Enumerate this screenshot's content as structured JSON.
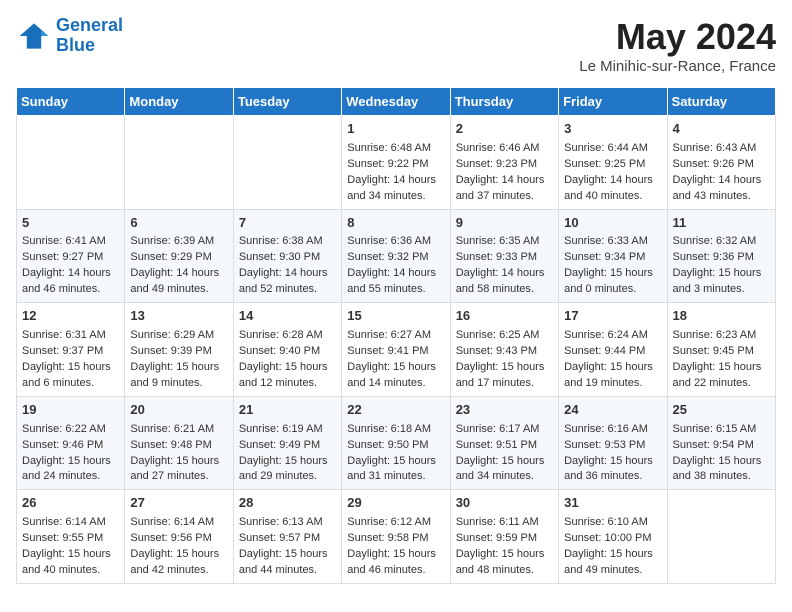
{
  "header": {
    "logo_general": "General",
    "logo_blue": "Blue",
    "month_title": "May 2024",
    "location": "Le Minihic-sur-Rance, France"
  },
  "weekdays": [
    "Sunday",
    "Monday",
    "Tuesday",
    "Wednesday",
    "Thursday",
    "Friday",
    "Saturday"
  ],
  "weeks": [
    [
      {
        "day": "",
        "sunrise": "",
        "sunset": "",
        "daylight": ""
      },
      {
        "day": "",
        "sunrise": "",
        "sunset": "",
        "daylight": ""
      },
      {
        "day": "",
        "sunrise": "",
        "sunset": "",
        "daylight": ""
      },
      {
        "day": "1",
        "sunrise": "Sunrise: 6:48 AM",
        "sunset": "Sunset: 9:22 PM",
        "daylight": "Daylight: 14 hours and 34 minutes."
      },
      {
        "day": "2",
        "sunrise": "Sunrise: 6:46 AM",
        "sunset": "Sunset: 9:23 PM",
        "daylight": "Daylight: 14 hours and 37 minutes."
      },
      {
        "day": "3",
        "sunrise": "Sunrise: 6:44 AM",
        "sunset": "Sunset: 9:25 PM",
        "daylight": "Daylight: 14 hours and 40 minutes."
      },
      {
        "day": "4",
        "sunrise": "Sunrise: 6:43 AM",
        "sunset": "Sunset: 9:26 PM",
        "daylight": "Daylight: 14 hours and 43 minutes."
      }
    ],
    [
      {
        "day": "5",
        "sunrise": "Sunrise: 6:41 AM",
        "sunset": "Sunset: 9:27 PM",
        "daylight": "Daylight: 14 hours and 46 minutes."
      },
      {
        "day": "6",
        "sunrise": "Sunrise: 6:39 AM",
        "sunset": "Sunset: 9:29 PM",
        "daylight": "Daylight: 14 hours and 49 minutes."
      },
      {
        "day": "7",
        "sunrise": "Sunrise: 6:38 AM",
        "sunset": "Sunset: 9:30 PM",
        "daylight": "Daylight: 14 hours and 52 minutes."
      },
      {
        "day": "8",
        "sunrise": "Sunrise: 6:36 AM",
        "sunset": "Sunset: 9:32 PM",
        "daylight": "Daylight: 14 hours and 55 minutes."
      },
      {
        "day": "9",
        "sunrise": "Sunrise: 6:35 AM",
        "sunset": "Sunset: 9:33 PM",
        "daylight": "Daylight: 14 hours and 58 minutes."
      },
      {
        "day": "10",
        "sunrise": "Sunrise: 6:33 AM",
        "sunset": "Sunset: 9:34 PM",
        "daylight": "Daylight: 15 hours and 0 minutes."
      },
      {
        "day": "11",
        "sunrise": "Sunrise: 6:32 AM",
        "sunset": "Sunset: 9:36 PM",
        "daylight": "Daylight: 15 hours and 3 minutes."
      }
    ],
    [
      {
        "day": "12",
        "sunrise": "Sunrise: 6:31 AM",
        "sunset": "Sunset: 9:37 PM",
        "daylight": "Daylight: 15 hours and 6 minutes."
      },
      {
        "day": "13",
        "sunrise": "Sunrise: 6:29 AM",
        "sunset": "Sunset: 9:39 PM",
        "daylight": "Daylight: 15 hours and 9 minutes."
      },
      {
        "day": "14",
        "sunrise": "Sunrise: 6:28 AM",
        "sunset": "Sunset: 9:40 PM",
        "daylight": "Daylight: 15 hours and 12 minutes."
      },
      {
        "day": "15",
        "sunrise": "Sunrise: 6:27 AM",
        "sunset": "Sunset: 9:41 PM",
        "daylight": "Daylight: 15 hours and 14 minutes."
      },
      {
        "day": "16",
        "sunrise": "Sunrise: 6:25 AM",
        "sunset": "Sunset: 9:43 PM",
        "daylight": "Daylight: 15 hours and 17 minutes."
      },
      {
        "day": "17",
        "sunrise": "Sunrise: 6:24 AM",
        "sunset": "Sunset: 9:44 PM",
        "daylight": "Daylight: 15 hours and 19 minutes."
      },
      {
        "day": "18",
        "sunrise": "Sunrise: 6:23 AM",
        "sunset": "Sunset: 9:45 PM",
        "daylight": "Daylight: 15 hours and 22 minutes."
      }
    ],
    [
      {
        "day": "19",
        "sunrise": "Sunrise: 6:22 AM",
        "sunset": "Sunset: 9:46 PM",
        "daylight": "Daylight: 15 hours and 24 minutes."
      },
      {
        "day": "20",
        "sunrise": "Sunrise: 6:21 AM",
        "sunset": "Sunset: 9:48 PM",
        "daylight": "Daylight: 15 hours and 27 minutes."
      },
      {
        "day": "21",
        "sunrise": "Sunrise: 6:19 AM",
        "sunset": "Sunset: 9:49 PM",
        "daylight": "Daylight: 15 hours and 29 minutes."
      },
      {
        "day": "22",
        "sunrise": "Sunrise: 6:18 AM",
        "sunset": "Sunset: 9:50 PM",
        "daylight": "Daylight: 15 hours and 31 minutes."
      },
      {
        "day": "23",
        "sunrise": "Sunrise: 6:17 AM",
        "sunset": "Sunset: 9:51 PM",
        "daylight": "Daylight: 15 hours and 34 minutes."
      },
      {
        "day": "24",
        "sunrise": "Sunrise: 6:16 AM",
        "sunset": "Sunset: 9:53 PM",
        "daylight": "Daylight: 15 hours and 36 minutes."
      },
      {
        "day": "25",
        "sunrise": "Sunrise: 6:15 AM",
        "sunset": "Sunset: 9:54 PM",
        "daylight": "Daylight: 15 hours and 38 minutes."
      }
    ],
    [
      {
        "day": "26",
        "sunrise": "Sunrise: 6:14 AM",
        "sunset": "Sunset: 9:55 PM",
        "daylight": "Daylight: 15 hours and 40 minutes."
      },
      {
        "day": "27",
        "sunrise": "Sunrise: 6:14 AM",
        "sunset": "Sunset: 9:56 PM",
        "daylight": "Daylight: 15 hours and 42 minutes."
      },
      {
        "day": "28",
        "sunrise": "Sunrise: 6:13 AM",
        "sunset": "Sunset: 9:57 PM",
        "daylight": "Daylight: 15 hours and 44 minutes."
      },
      {
        "day": "29",
        "sunrise": "Sunrise: 6:12 AM",
        "sunset": "Sunset: 9:58 PM",
        "daylight": "Daylight: 15 hours and 46 minutes."
      },
      {
        "day": "30",
        "sunrise": "Sunrise: 6:11 AM",
        "sunset": "Sunset: 9:59 PM",
        "daylight": "Daylight: 15 hours and 48 minutes."
      },
      {
        "day": "31",
        "sunrise": "Sunrise: 6:10 AM",
        "sunset": "Sunset: 10:00 PM",
        "daylight": "Daylight: 15 hours and 49 minutes."
      },
      {
        "day": "",
        "sunrise": "",
        "sunset": "",
        "daylight": ""
      }
    ]
  ]
}
